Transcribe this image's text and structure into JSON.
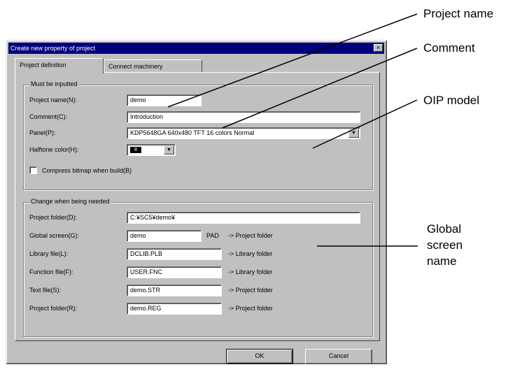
{
  "dialog": {
    "title": "Create new property of project",
    "close_glyph": "×",
    "tabs": [
      "Project definition",
      "Connect machinery"
    ]
  },
  "must_be_inputted": {
    "title": "Must be inputted",
    "project_name_label": "Project name(N):",
    "project_name_value": "demo",
    "comment_label": "Comment(C):",
    "comment_value": "Introduction",
    "panel_label": "Panel(P):",
    "panel_value": "KDP5648GA 640x480 TFT 16 colors Normal",
    "halftone_label": "Halftone color(H):",
    "halftone_value": "8",
    "compress_label": "Compress bitmap when build(B)",
    "compress_checked": false
  },
  "change_when_needed": {
    "title": "Change when being needed",
    "rows": [
      {
        "label": "Project folder(D):",
        "value": "C:¥SC5¥demo¥",
        "suffix": "",
        "note": ""
      },
      {
        "label": "Global screen(G):",
        "value": "demo",
        "suffix": "PAD",
        "note": "-> Project folder"
      },
      {
        "label": "Library file(L):",
        "value": "DCLIB.PLB",
        "suffix": "",
        "note": "-> Library folder"
      },
      {
        "label": "Function file(F):",
        "value": "USER.FNC",
        "suffix": "",
        "note": "-> Library folder"
      },
      {
        "label": "Text file(S):",
        "value": "demo.STR",
        "suffix": "",
        "note": "-> Project folder"
      },
      {
        "label": "Project folder(R):",
        "value": "demo.REG",
        "suffix": "",
        "note": "-> Project folder"
      }
    ]
  },
  "buttons": {
    "ok": "OK",
    "cancel": "Cancel"
  },
  "callouts": {
    "project_name": "Project name",
    "comment": "Comment",
    "oip_model": "OIP model",
    "global_screen_line1": "Global",
    "global_screen_line2": "screen",
    "global_screen_line3": "name"
  }
}
